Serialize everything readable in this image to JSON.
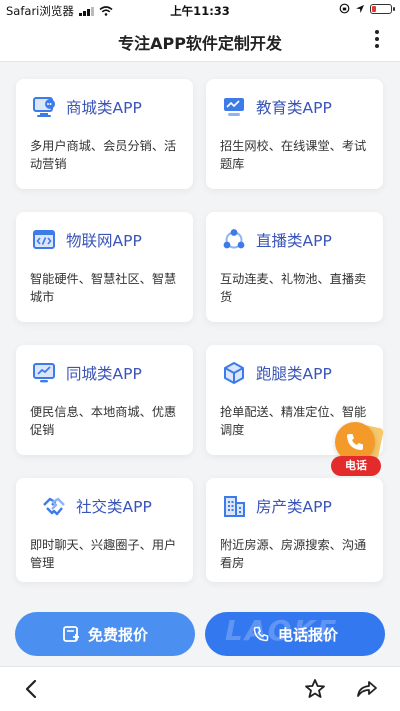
{
  "status_bar": {
    "carrier": "Safari浏览器",
    "time": "上午11:33"
  },
  "header": {
    "title": "专注APP软件定制开发"
  },
  "cards": [
    {
      "title": "商城类APP",
      "desc": "多用户商城、会员分销、活动营销",
      "icon": "monitor-chat-icon"
    },
    {
      "title": "教育类APP",
      "desc": "招生网校、在线课堂、考试题库",
      "icon": "classroom-board-icon"
    },
    {
      "title": "物联网APP",
      "desc": "智能硬件、智慧社区、智慧城市",
      "icon": "code-window-icon"
    },
    {
      "title": "直播类APP",
      "desc": "互动连麦、礼物池、直播卖货",
      "icon": "network-nodes-icon"
    },
    {
      "title": "同城类APP",
      "desc": "便民信息、本地商城、优惠促销",
      "icon": "monitor-chart-icon"
    },
    {
      "title": "跑腿类APP",
      "desc": "抢单配送、精准定位、智能调度",
      "icon": "cube-box-icon"
    },
    {
      "title": "社交类APP",
      "desc": "即时聊天、兴趣圈子、用户管理",
      "icon": "handshake-icon"
    },
    {
      "title": "房产类APP",
      "desc": "附近房源、房源搜索、沟通看房",
      "icon": "building-icon"
    }
  ],
  "float_call": {
    "label": "电话"
  },
  "bottom_buttons": {
    "quote_label": "免费报价",
    "call_label": "电话报价",
    "watermark": "LAOKE"
  },
  "colors": {
    "card_title": "#3a55b8",
    "icon_blue": "#3d7be8",
    "btn_left": "#4b8ff0",
    "btn_right": "#3478f0",
    "float_label": "#e32b2b"
  }
}
